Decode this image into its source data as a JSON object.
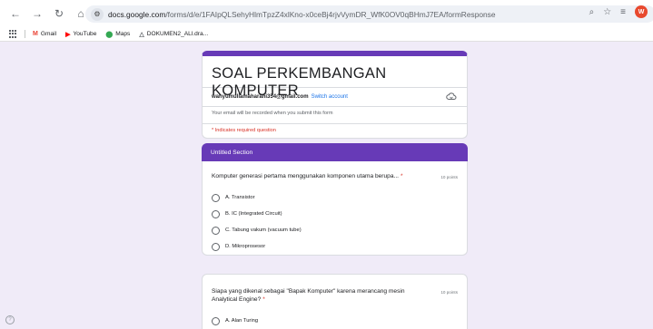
{
  "browser": {
    "url_host": "docs.google.com",
    "url_path": "/forms/d/e/1FAIpQLSehyHlmTpzZ4xlKno-x0ceBj4rjvVymDR_WfK0OV0qBHmJ7EA/formResponse",
    "profile_initial": "W",
    "nav_icons": [
      "back-icon",
      "forward-icon",
      "reload-icon",
      "home-icon"
    ]
  },
  "bookmarks": [
    {
      "icon": "M",
      "label": "Gmail",
      "color": "#ea4335"
    },
    {
      "icon": "▶",
      "label": "YouTube",
      "color": "#ff0000"
    },
    {
      "icon": "⬤",
      "label": "Maps",
      "color": "#34a853"
    },
    {
      "icon": "△",
      "label": "DOKUMEN2_ALl.dra...",
      "color": "#5f6368"
    }
  ],
  "form": {
    "title": "SOAL PERKEMBANGAN KOMPUTER",
    "email": "wahyumuliamaharani354@gmail.com",
    "switch_account": "Switch account",
    "record_note": "Your email will be recorded when you submit this form",
    "required_note": "* Indicates required question",
    "section_title": "Untitled Section",
    "accent_color": "#673ab7",
    "background_color": "#f0ebf8",
    "questions": [
      {
        "text": "Komputer generasi pertama menggunakan komponen utama berupa...",
        "required": "*",
        "points": "10 points",
        "options": [
          "A. Transistor",
          "B. IC (Integrated Circuit)",
          "C. Tabung vakum (vacuum tube)",
          "D. Mikroprosesor"
        ]
      },
      {
        "text": "Siapa yang dikenal sebagai \"Bapak Komputer\" karena merancang mesin Analytical Engine?",
        "required": "*",
        "points": "10 points",
        "options": [
          "A. Alan Turing"
        ]
      }
    ]
  },
  "help": "?"
}
